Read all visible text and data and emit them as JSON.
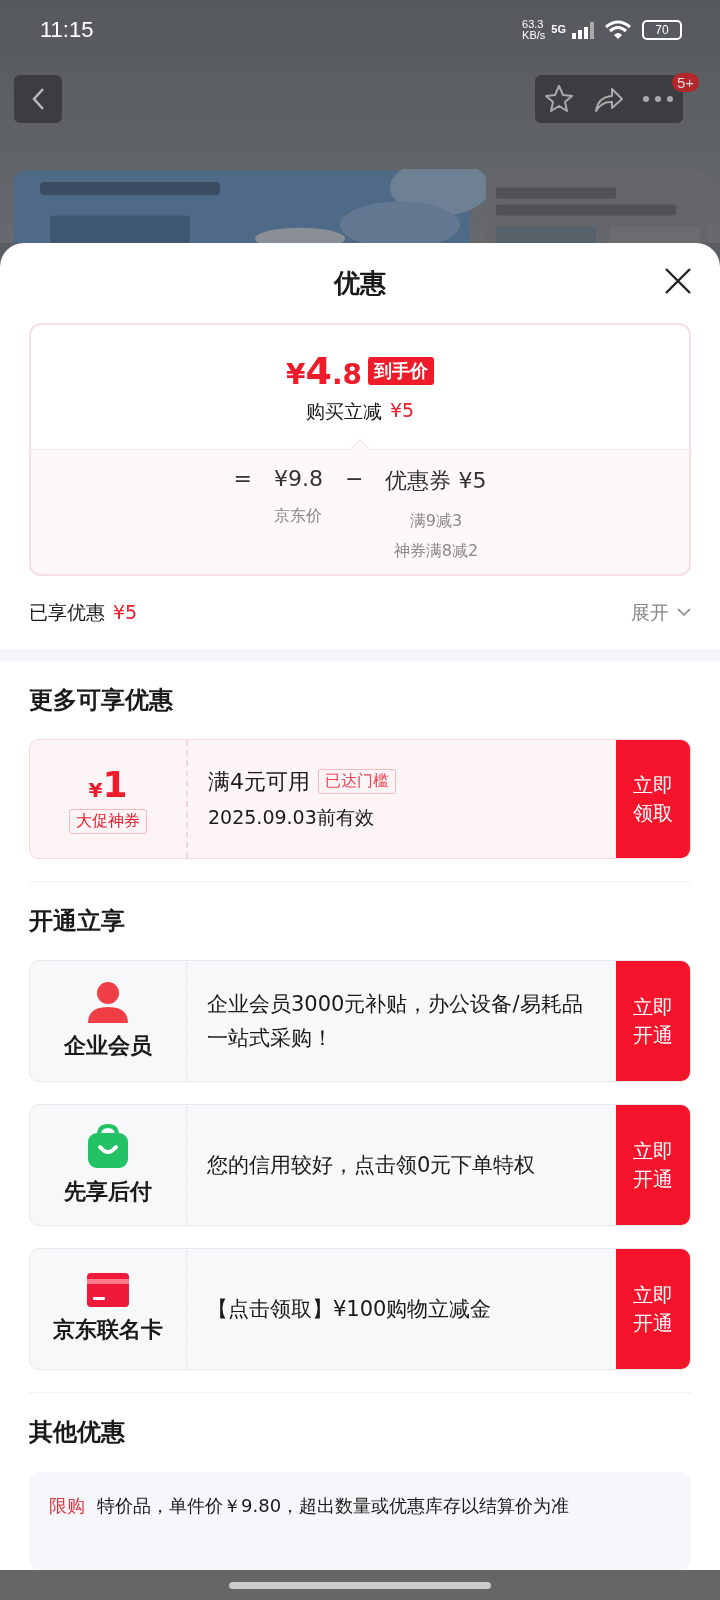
{
  "status_bar": {
    "time": "11:15",
    "net_speed": "63.3",
    "net_unit": "KB/s",
    "network": "5G",
    "battery": "70"
  },
  "nav": {
    "badge": "5+"
  },
  "sheet": {
    "title": "优惠"
  },
  "price": {
    "currency": "¥",
    "integer": "4",
    "decimal": ".8",
    "tag": "到手价",
    "subtitle": "购买立减",
    "subtitle_amount": "¥5"
  },
  "breakdown": {
    "equals": "=",
    "base": "¥9.8",
    "base_label": "京东价",
    "minus": "−",
    "coupon": "优惠券 ¥5",
    "coupon_notes": [
      "满9减3",
      "神券满8减2"
    ]
  },
  "enjoyed": {
    "label": "已享优惠",
    "amount": "¥5",
    "expand": "展开"
  },
  "more": {
    "title": "更多可享优惠",
    "coupons": [
      {
        "currency": "¥",
        "amount": "1",
        "tag": "大促神券",
        "condition": "满4元可用",
        "badge": "已达门槛",
        "validity": "2025.09.03前有效",
        "button": "立即领取"
      }
    ]
  },
  "open": {
    "title": "开通立享",
    "items": [
      {
        "kind": "member",
        "name": "企业会员",
        "desc": "企业会员3000元补贴，办公设备/易耗品一站式采购！",
        "button": "立即开通"
      },
      {
        "kind": "bag",
        "name": "先享后付",
        "desc": "您的信用较好，点击领0元下单特权",
        "button": "立即开通"
      },
      {
        "kind": "card",
        "name": "京东联名卡",
        "desc": "【点击领取】¥100购物立减金",
        "button": "立即开通"
      }
    ]
  },
  "other": {
    "title": "其他优惠",
    "items": [
      {
        "tag": "限购",
        "text": "特价品，单件价￥9.80，超出数量或优惠库存以结算价为准"
      }
    ]
  }
}
